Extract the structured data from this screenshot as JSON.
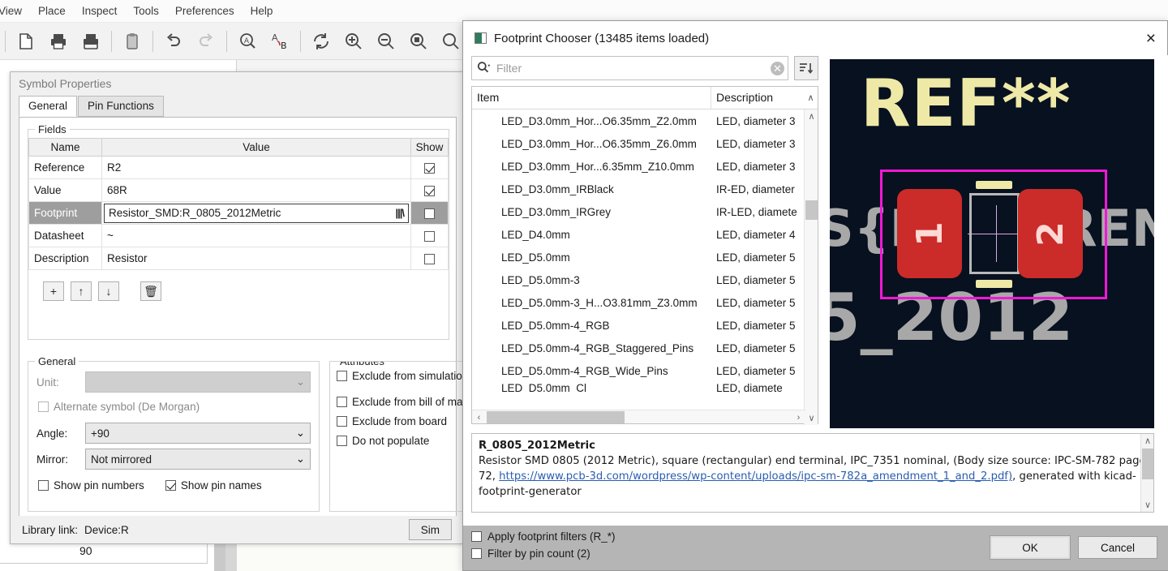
{
  "app": {
    "menus": [
      "View",
      "Place",
      "Inspect",
      "Tools",
      "Preferences",
      "Help"
    ],
    "toolbar_icons": [
      "new-sheet-icon",
      "print-icon",
      "plot-icon",
      "paste-icon",
      "undo-icon",
      "redo-icon",
      "find-icon",
      "find-replace-icon",
      "refresh-icon",
      "zoom-in-icon",
      "zoom-out-icon",
      "zoom-fit-icon",
      "zoom-area-icon"
    ],
    "grid_value": "90"
  },
  "symbol_properties": {
    "title": "Symbol Properties",
    "tabs": [
      {
        "label": "General",
        "active": true
      },
      {
        "label": "Pin Functions",
        "active": false
      }
    ],
    "fields_group_label": "Fields",
    "columns": {
      "name": "Name",
      "value": "Value",
      "show": "Show"
    },
    "rows": [
      {
        "name": "Reference",
        "value": "R2",
        "show": true,
        "selected": false,
        "editing": false
      },
      {
        "name": "Value",
        "value": "68R",
        "show": true,
        "selected": false,
        "editing": false
      },
      {
        "name": "Footprint",
        "value": "Resistor_SMD:R_0805_2012Metric",
        "show": false,
        "selected": true,
        "editing": true
      },
      {
        "name": "Datasheet",
        "value": "~",
        "show": false,
        "selected": false,
        "editing": false
      },
      {
        "name": "Description",
        "value": "Resistor",
        "show": false,
        "selected": false,
        "editing": false
      }
    ],
    "row_buttons": [
      {
        "name": "add-field-button",
        "glyph": "+"
      },
      {
        "name": "move-up-button",
        "glyph": "↑"
      },
      {
        "name": "move-down-button",
        "glyph": "↓"
      },
      {
        "name": "delete-field-button",
        "glyph": "🗑"
      }
    ],
    "general_group_label": "General",
    "unit_label": "Unit:",
    "unit_value": "",
    "alternate_symbol_label": "Alternate symbol (De Morgan)",
    "alternate_symbol_checked": false,
    "angle_label": "Angle:",
    "angle_value": "+90",
    "mirror_label": "Mirror:",
    "mirror_value": "Not mirrored",
    "show_pin_numbers_label": "Show pin numbers",
    "show_pin_numbers_checked": false,
    "show_pin_names_label": "Show pin names",
    "show_pin_names_checked": true,
    "attributes_group_label": "Attributes",
    "attributes": [
      {
        "label": "Exclude from simulation",
        "checked": false
      },
      {
        "label": "Exclude from bill of mat",
        "checked": false
      },
      {
        "label": "Exclude from board",
        "checked": false
      },
      {
        "label": "Do not populate",
        "checked": false
      }
    ],
    "library_link_label": "Library link:",
    "library_link_value": "Device:R",
    "sim_button_label": "Sim"
  },
  "footprint_chooser": {
    "title": "Footprint Chooser (13485 items loaded)",
    "close_label": "×",
    "filter": {
      "value": "",
      "placeholder": "Filter",
      "search_icon": "search-icon",
      "clear_icon": "clear-icon",
      "sort_icon": "sort-icon"
    },
    "columns": {
      "item": "Item",
      "description": "Description"
    },
    "items": [
      {
        "item": "LED_D3.0mm_Hor...O6.35mm_Z2.0mm",
        "description": "LED, diameter 3"
      },
      {
        "item": "LED_D3.0mm_Hor...O6.35mm_Z6.0mm",
        "description": "LED, diameter 3"
      },
      {
        "item": "LED_D3.0mm_Hor...6.35mm_Z10.0mm",
        "description": "LED, diameter 3"
      },
      {
        "item": "LED_D3.0mm_IRBlack",
        "description": "IR-ED, diameter"
      },
      {
        "item": "LED_D3.0mm_IRGrey",
        "description": "IR-LED, diamete"
      },
      {
        "item": "LED_D4.0mm",
        "description": "LED, diameter 4"
      },
      {
        "item": "LED_D5.0mm",
        "description": "LED, diameter 5"
      },
      {
        "item": "LED_D5.0mm-3",
        "description": "LED, diameter 5"
      },
      {
        "item": "LED_D5.0mm-3_H...O3.81mm_Z3.0mm",
        "description": "LED, diameter 5"
      },
      {
        "item": "LED_D5.0mm-4_RGB",
        "description": "LED, diameter 5"
      },
      {
        "item": "LED_D5.0mm-4_RGB_Staggered_Pins",
        "description": "LED, diameter 5"
      },
      {
        "item": "LED_D5.0mm-4_RGB_Wide_Pins",
        "description": "LED, diameter 5"
      },
      {
        "item": "LED_D5.0mm_Cl",
        "description": "LED, diamete"
      }
    ],
    "preview": {
      "reference_text": "REF**",
      "silk_text_1": "S{R",
      "silk_text_2": "ERENCE",
      "silk_text_3": "5_2012",
      "pad1_label": "1",
      "pad2_label": "2",
      "colors": {
        "background": "#07111f",
        "pad": "#cb2b29",
        "courtyard": "#f018d8",
        "silkscreen": "#efe9a8",
        "fabrication": "#a8a8a8"
      }
    },
    "description": {
      "title": "R_0805_2012Metric",
      "text_before_link": "Resistor SMD 0805 (2012 Metric), square (rectangular) end terminal, IPC_7351 nominal, (Body size source: IPC-SM-782 page 72, ",
      "link_text": "https://www.pcb-3d.com/wordpress/wp-content/uploads/ipc-sm-782a_amendment_1_and_2.pdf)",
      "text_after_link": ", generated with kicad-footprint-generator"
    },
    "options": [
      {
        "label": "Apply footprint filters (R_*)",
        "checked": false
      },
      {
        "label": "Filter by pin count (2)",
        "checked": false
      }
    ],
    "buttons": {
      "ok": "OK",
      "cancel": "Cancel"
    }
  }
}
